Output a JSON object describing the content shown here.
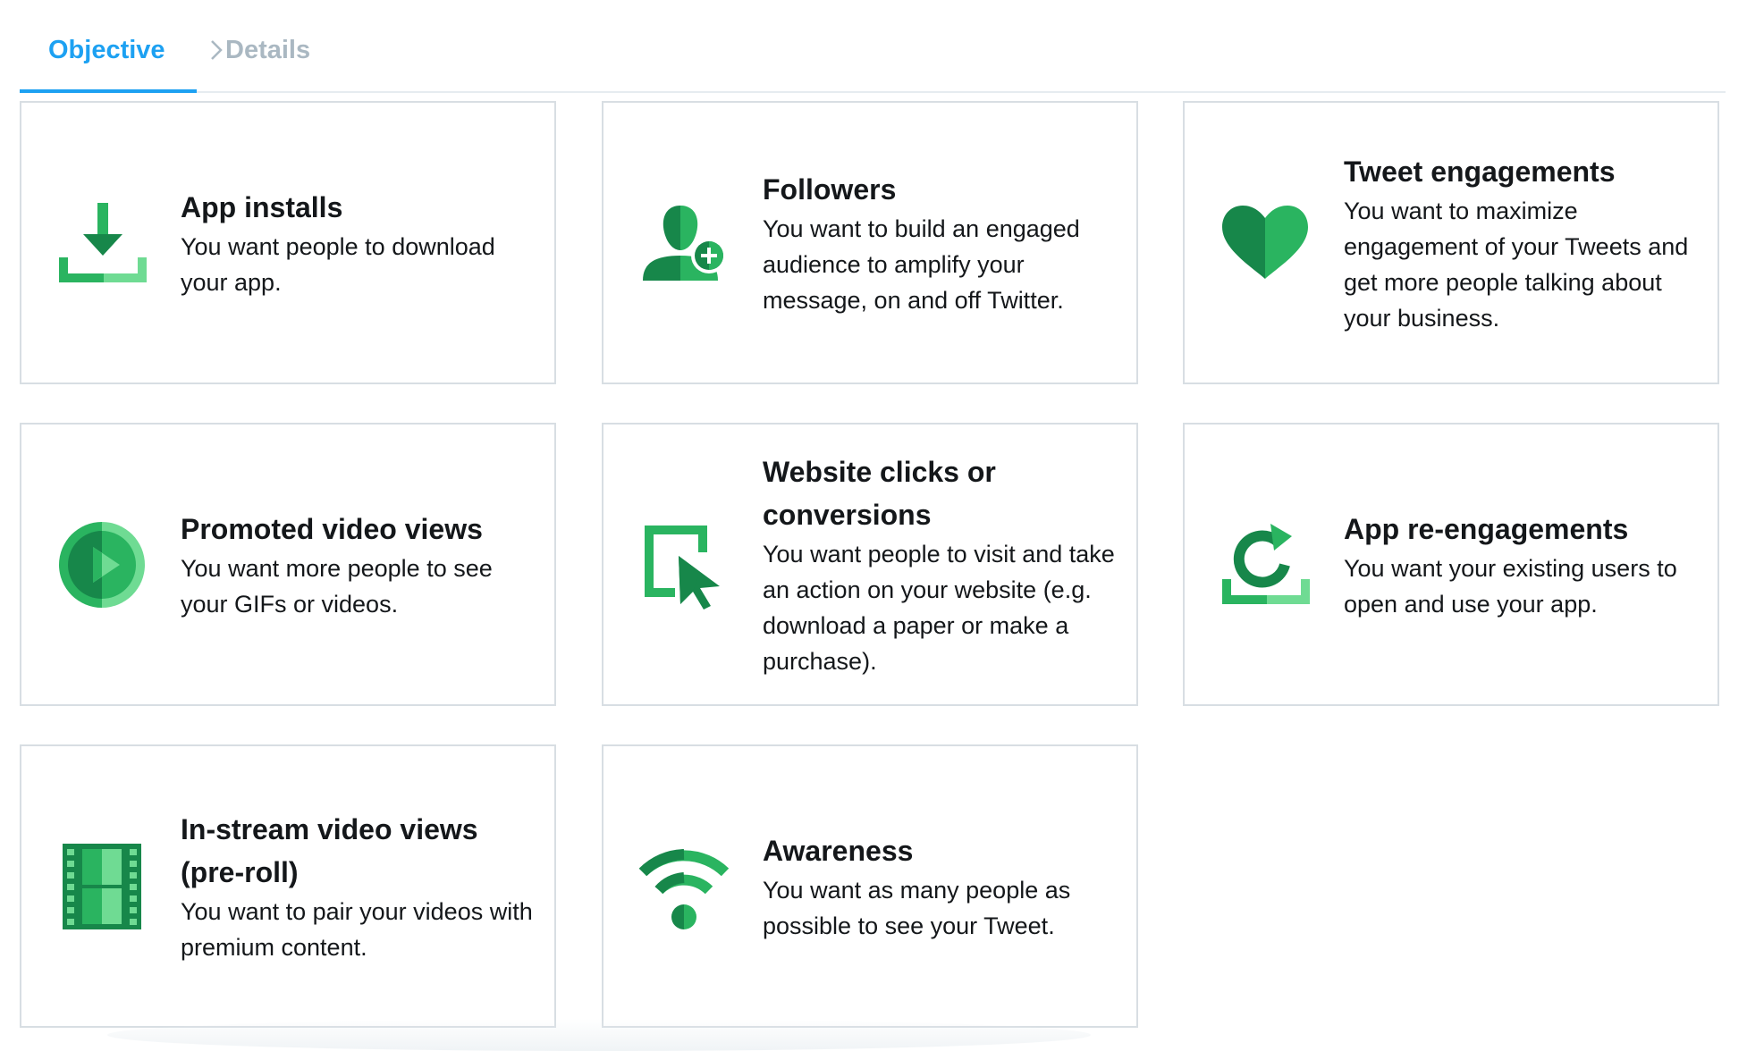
{
  "tabs": {
    "objective_label": "Objective",
    "details_label": "Details"
  },
  "colors": {
    "accent": "#1da1f2",
    "icon_dark": "#17874a",
    "icon_mid": "#2ab460",
    "icon_light": "#6fdb93"
  },
  "cards": [
    {
      "title": "App installs",
      "description": "You want people to download your app.",
      "icon": "download-icon"
    },
    {
      "title": "Followers",
      "description": "You want to build an engaged audience to amplify your message, on and off Twitter.",
      "icon": "add-follower-icon"
    },
    {
      "title": "Tweet engagements",
      "description": "You want to maximize engagement of your Tweets and get more people talking about your business.",
      "icon": "heart-icon"
    },
    {
      "title": "Promoted video views",
      "description": "You want more people to see your GIFs or videos.",
      "icon": "play-icon"
    },
    {
      "title": "Website clicks or conversions",
      "description": "You want people to visit and take an action on your website (e.g. download a paper or make a purchase).",
      "icon": "cursor-click-icon"
    },
    {
      "title": "App re-engagements",
      "description": "You want your existing users to open and use your app.",
      "icon": "refresh-icon"
    },
    {
      "title": "In-stream video views (pre-roll)",
      "description": "You want to pair your videos with premium content.",
      "icon": "film-strip-icon"
    },
    {
      "title": "Awareness",
      "description": "You want as many people as possible to see your Tweet.",
      "icon": "broadcast-signal-icon"
    }
  ]
}
